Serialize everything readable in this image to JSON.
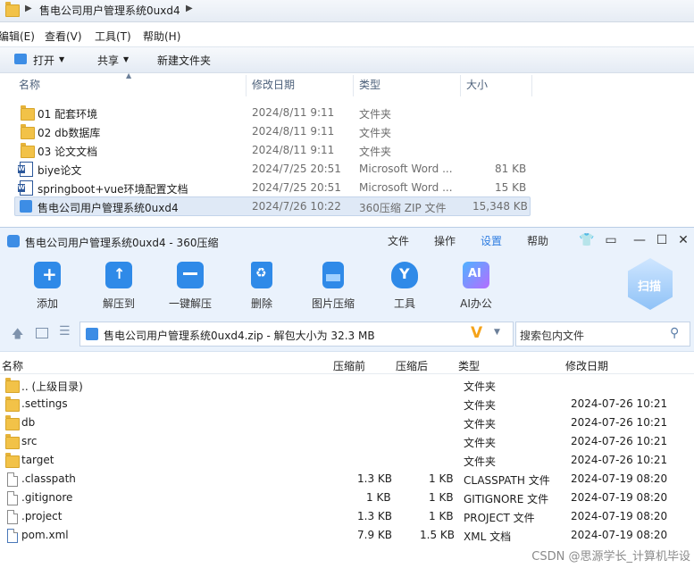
{
  "explorer": {
    "breadcrumb": "售电公司用户管理系统0uxd4",
    "menu": [
      "编辑(E)",
      "查看(V)",
      "工具(T)",
      "帮助(H)"
    ],
    "toolbar": {
      "open": "打开",
      "share": "共享",
      "new_folder": "新建文件夹"
    },
    "columns": {
      "name": "名称",
      "modified": "修改日期",
      "type": "类型",
      "size": "大小"
    },
    "files": [
      {
        "name": "01 配套环境",
        "modified": "2024/8/11 9:11",
        "type": "文件夹",
        "size": "",
        "icon": "folder-icon"
      },
      {
        "name": "02 db数据库",
        "modified": "2024/8/11 9:11",
        "type": "文件夹",
        "size": "",
        "icon": "folder-icon"
      },
      {
        "name": "03 论文文档",
        "modified": "2024/8/11 9:11",
        "type": "文件夹",
        "size": "",
        "icon": "folder-icon"
      },
      {
        "name": "biye论文",
        "modified": "2024/7/25 20:51",
        "type": "Microsoft Word ...",
        "size": "81 KB",
        "icon": "word-icon"
      },
      {
        "name": "springboot+vue环境配置文档",
        "modified": "2024/7/25 20:51",
        "type": "Microsoft Word ...",
        "size": "15 KB",
        "icon": "word-icon"
      },
      {
        "name": "售电公司用户管理系统0uxd4",
        "modified": "2024/7/26 10:22",
        "type": "360压缩 ZIP 文件",
        "size": "15,348 KB",
        "icon": "zip-icon"
      }
    ]
  },
  "zip": {
    "title": "售电公司用户管理系统0uxd4 - 360压缩",
    "menu": [
      "文件",
      "操作",
      "设置",
      "帮助"
    ],
    "ribbon": [
      "添加",
      "解压到",
      "一键解压",
      "删除",
      "图片压缩",
      "工具",
      "AI办公"
    ],
    "ai_badge": "AI",
    "scan_label": "扫描",
    "path": "售电公司用户管理系统0uxd4.zip - 解包大小为 32.3 MB",
    "search_placeholder": "搜索包内文件",
    "columns": {
      "name": "名称",
      "compressed_before": "压缩前",
      "compressed_after": "压缩后",
      "type": "类型",
      "modified": "修改日期"
    },
    "rows": [
      {
        "name": ".. (上级目录)",
        "before": "",
        "after": "",
        "type": "文件夹",
        "modified": "",
        "icon": "folder-icon"
      },
      {
        "name": ".settings",
        "before": "",
        "after": "",
        "type": "文件夹",
        "modified": "2024-07-26 10:21",
        "icon": "folder-icon"
      },
      {
        "name": "db",
        "before": "",
        "after": "",
        "type": "文件夹",
        "modified": "2024-07-26 10:21",
        "icon": "folder-icon"
      },
      {
        "name": "src",
        "before": "",
        "after": "",
        "type": "文件夹",
        "modified": "2024-07-26 10:21",
        "icon": "folder-icon"
      },
      {
        "name": "target",
        "before": "",
        "after": "",
        "type": "文件夹",
        "modified": "2024-07-26 10:21",
        "icon": "folder-icon"
      },
      {
        "name": ".classpath",
        "before": "1.3 KB",
        "after": "1 KB",
        "type": "CLASSPATH 文件",
        "modified": "2024-07-19 08:20",
        "icon": "file-icon"
      },
      {
        "name": ".gitignore",
        "before": "1 KB",
        "after": "1 KB",
        "type": "GITIGNORE 文件",
        "modified": "2024-07-19 08:20",
        "icon": "file-icon"
      },
      {
        "name": ".project",
        "before": "1.3 KB",
        "after": "1 KB",
        "type": "PROJECT 文件",
        "modified": "2024-07-19 08:20",
        "icon": "file-icon"
      },
      {
        "name": "pom.xml",
        "before": "7.9 KB",
        "after": "1.5 KB",
        "type": "XML 文档",
        "modified": "2024-07-19 08:20",
        "icon": "xml-file-icon"
      }
    ]
  },
  "watermark": "CSDN @思源学长_计算机毕设"
}
